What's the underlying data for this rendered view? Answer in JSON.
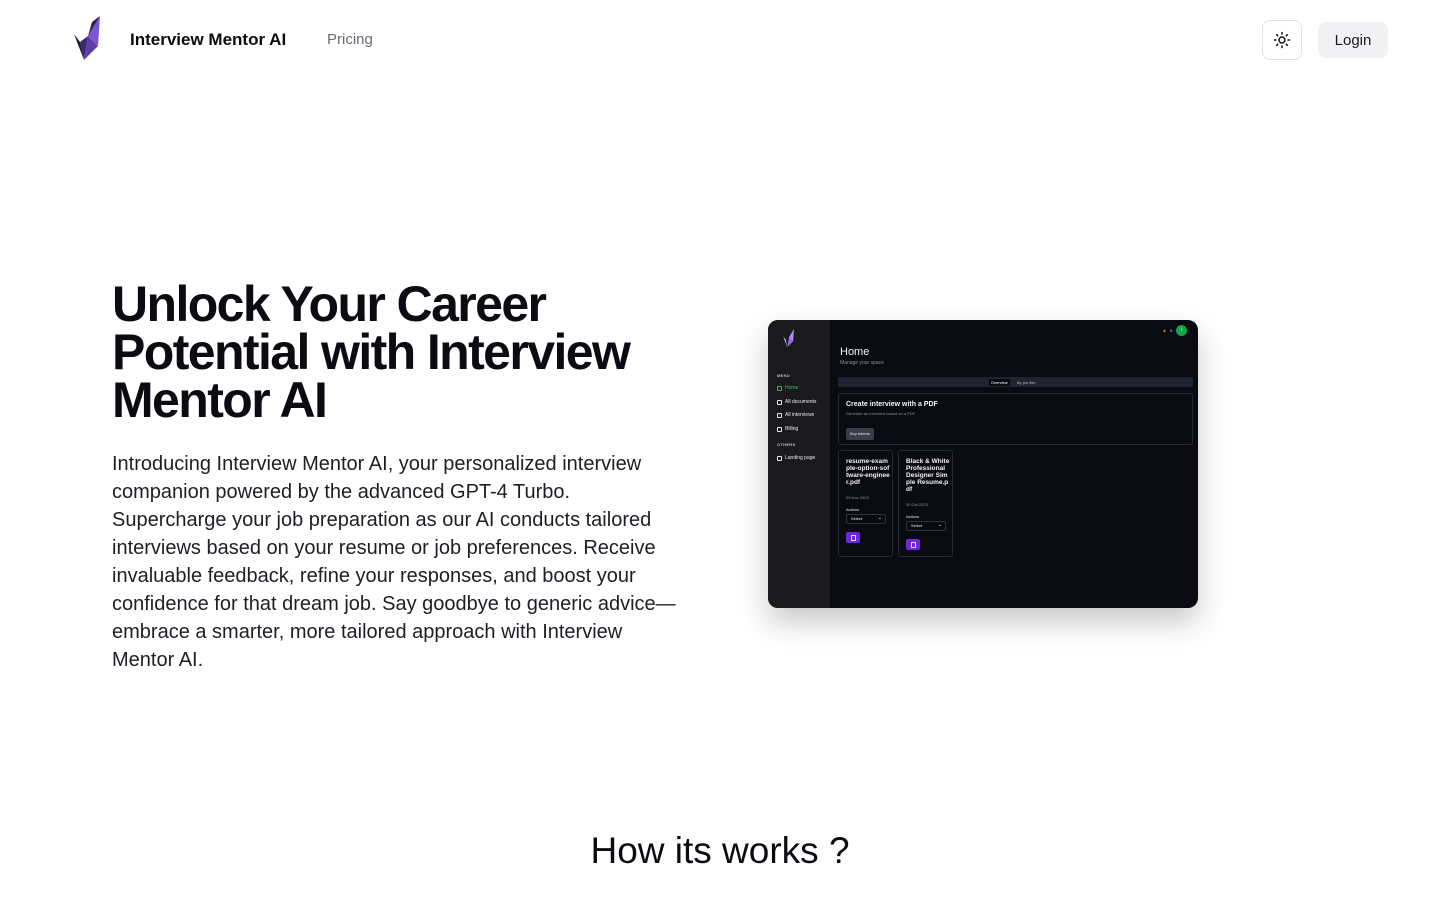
{
  "nav": {
    "brand": "Interview Mentor AI",
    "links": [
      {
        "label": "Pricing"
      }
    ],
    "theme_icon": "sun-icon",
    "login_label": "Login"
  },
  "hero": {
    "title": "Unlock Your Career Potential with Interview Mentor AI",
    "description": "Introducing Interview Mentor AI, your personalized interview companion powered by the advanced GPT-4 Turbo. Supercharge your job preparation as our AI conducts tailored interviews based on your resume or job preferences. Receive invaluable feedback, refine your responses, and boost your confidence for that dream job. Say goodbye to generic advice—embrace a smarter, more tailored approach with Interview Mentor AI."
  },
  "preview": {
    "menu_label": "MENU",
    "menu_items": [
      {
        "label": "Home",
        "icon": "home-icon",
        "active": true
      },
      {
        "label": "All documents",
        "icon": "documents-icon"
      },
      {
        "label": "All interviews",
        "icon": "interviews-icon"
      },
      {
        "label": "Billing",
        "icon": "billing-icon"
      }
    ],
    "others_label": "OTHERS",
    "others_items": [
      {
        "label": "Landing page",
        "icon": "home-icon"
      }
    ],
    "tokens": "0",
    "avatar_initial": "i",
    "title": "Home",
    "subtitle": "Manage your space",
    "tabs": [
      "Overview",
      "By job title"
    ],
    "create_card": {
      "title": "Create interview with a PDF",
      "subtitle": "Generate an interview based on a PDF",
      "button": "Buy tokens"
    },
    "documents": [
      {
        "name": "resume-example-option-software-engineer.pdf",
        "date": "09 Nov 2023",
        "actions_label": "Actions",
        "select": "Select"
      },
      {
        "name": "Black & White Professional Designer Simple Resume.pdf",
        "date": "30 Oct 2023",
        "actions_label": "Actions",
        "select": "Select"
      }
    ]
  },
  "how": {
    "title": "How its works ?"
  },
  "colors": {
    "text": "#0b0b12",
    "muted": "#6b6b75",
    "preview_bg": "#0a0b12",
    "accent_green": "#22c55e",
    "accent_purple": "#6d28d9"
  }
}
